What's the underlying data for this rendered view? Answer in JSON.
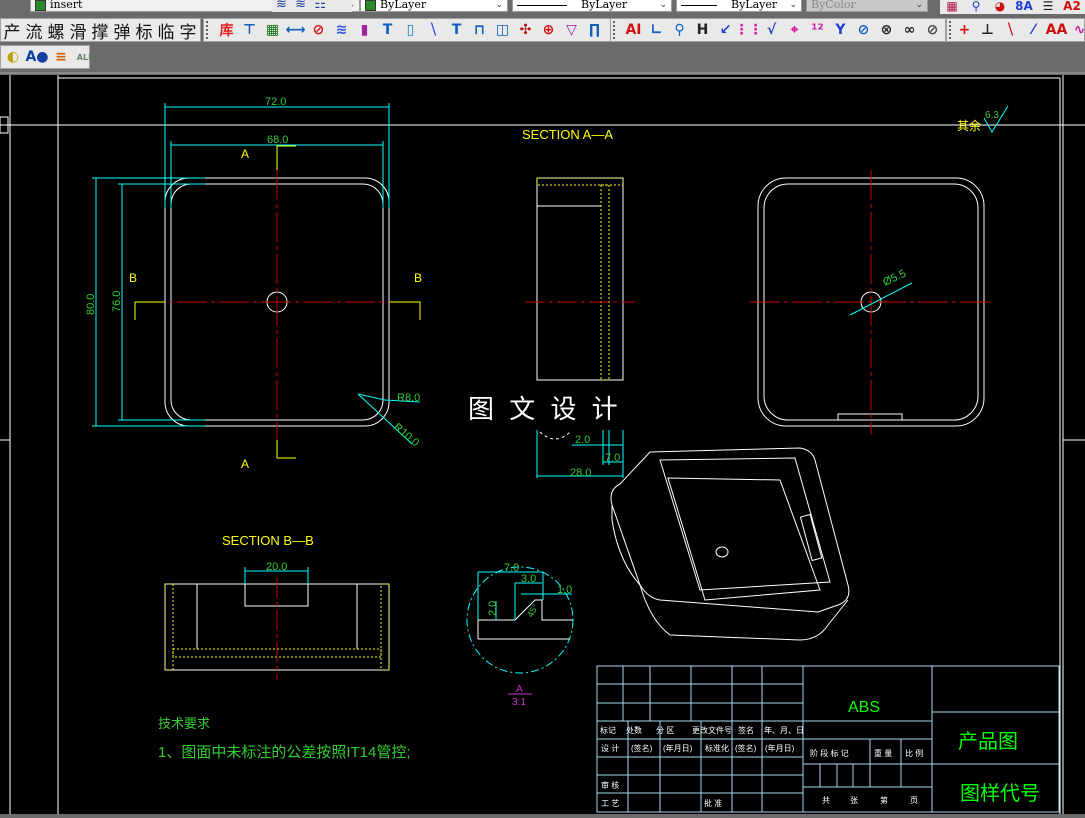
{
  "toolbar_top": {
    "layer_name": "insert",
    "color": "ByLayer",
    "linetype": "ByLayer",
    "lineweight": "ByLayer",
    "plotstyle": "ByColor"
  },
  "toolbar_chinese": [
    "产",
    "流",
    "螺",
    "滑",
    "撑",
    "弹",
    "标",
    "临",
    "字"
  ],
  "toolbar_icons_1": [
    {
      "name": "library-icon",
      "glyph": "库",
      "color": "#e02020"
    },
    {
      "name": "hole-icon",
      "glyph": "⊤",
      "color": "#1060c0"
    },
    {
      "name": "bearing-icon",
      "glyph": "▦",
      "color": "#107010"
    },
    {
      "name": "shaft-icon",
      "glyph": "⟷",
      "color": "#1060c0"
    },
    {
      "name": "gear-icon",
      "glyph": "⊘",
      "color": "#d01010"
    },
    {
      "name": "spring-icon",
      "glyph": "≋",
      "color": "#3050e0"
    },
    {
      "name": "screw-icon",
      "glyph": "▮",
      "color": "#a020a0"
    },
    {
      "name": "t-slot-icon",
      "glyph": "T",
      "color": "#1060c0"
    },
    {
      "name": "pin-icon",
      "glyph": "▯",
      "color": "#1080c0"
    },
    {
      "name": "hatch-icon",
      "glyph": "⧹",
      "color": "#3050e0"
    },
    {
      "name": "bolt-icon",
      "glyph": "T",
      "color": "#1060c0"
    },
    {
      "name": "nut-icon",
      "glyph": "⊓",
      "color": "#1060c0"
    },
    {
      "name": "coupling-icon",
      "glyph": "◫",
      "color": "#1060c0"
    },
    {
      "name": "chain-icon",
      "glyph": "✣",
      "color": "#b01010"
    },
    {
      "name": "center-mark-icon",
      "glyph": "⊕",
      "color": "#d01010"
    },
    {
      "name": "countersink-icon",
      "glyph": "▽",
      "color": "#a020a0"
    },
    {
      "name": "bracket-icon",
      "glyph": "∏",
      "color": "#1060c0"
    }
  ],
  "toolbar_icons_2": [
    {
      "name": "text-icon",
      "glyph": "AI",
      "color": "#d01010"
    },
    {
      "name": "coordinate-icon",
      "glyph": "∟",
      "color": "#1060c0"
    },
    {
      "name": "leader-icon",
      "glyph": "⚲",
      "color": "#1060c0"
    },
    {
      "name": "dimension-icon",
      "glyph": "H",
      "color": "#222"
    },
    {
      "name": "tolerance-icon",
      "glyph": "↙",
      "color": "#2040d0"
    },
    {
      "name": "numbering-icon",
      "glyph": "⋮⋮",
      "color": "#d020a0"
    },
    {
      "name": "roughness-icon",
      "glyph": "√",
      "color": "#2040d0"
    },
    {
      "name": "datum-icon",
      "glyph": "⌖",
      "color": "#d020a0"
    },
    {
      "name": "sequence-icon",
      "glyph": "¹²",
      "color": "#d020a0"
    },
    {
      "name": "weld-icon",
      "glyph": "Y",
      "color": "#2040d0"
    },
    {
      "name": "diameter-icon",
      "glyph": "⊘",
      "color": "#1060c0"
    },
    {
      "name": "radius-icon",
      "glyph": "⊗",
      "color": "#222"
    },
    {
      "name": "edit-icon",
      "glyph": "∞",
      "color": "#222"
    },
    {
      "name": "erase-icon",
      "glyph": "⊘",
      "color": "#444"
    }
  ],
  "toolbar_icons_3": [
    {
      "name": "centerline-icon",
      "glyph": "+",
      "color": "#d01010"
    },
    {
      "name": "break-icon",
      "glyph": "⊥",
      "color": "#222"
    },
    {
      "name": "hatch-line-icon",
      "glyph": "⧹",
      "color": "#d01010"
    },
    {
      "name": "scale-icon",
      "glyph": "⁄",
      "color": "#2040d0"
    },
    {
      "name": "text-align-icon",
      "glyph": "AA",
      "color": "#d01010"
    },
    {
      "name": "curve-icon",
      "glyph": "∿",
      "color": "#d020a0"
    }
  ],
  "toolbar_icons_top_right": [
    {
      "name": "table-icon",
      "glyph": "▦",
      "color": "#b01040"
    },
    {
      "name": "zoom-icon",
      "glyph": "⚲",
      "color": "#2040d0"
    },
    {
      "name": "properties-icon",
      "glyph": "◕",
      "color": "#d01010"
    },
    {
      "name": "layer-state-icon",
      "glyph": "8Â",
      "color": "#2040d0"
    },
    {
      "name": "list-icon",
      "glyph": "☰",
      "color": "#222"
    },
    {
      "name": "text-style-icon",
      "glyph": "A2",
      "color": "#d01010"
    }
  ],
  "toolbar_row3": [
    {
      "name": "layer-match-icon",
      "glyph": "◐",
      "color": "#c0a000"
    },
    {
      "name": "text-match-icon",
      "glyph": "A●",
      "color": "#1040a0"
    },
    {
      "name": "layer-stack-icon",
      "glyph": "≡",
      "color": "#d06000"
    },
    {
      "name": "all-dim-icon",
      "glyph": "ALL",
      "color": "#608060"
    }
  ],
  "drawing": {
    "section_aa": "SECTION  A—A",
    "section_bb": "SECTION  B—B",
    "label_a": "A",
    "label_b": "B",
    "dims_front": {
      "width_outer": "72.0",
      "width_inner": "68.0",
      "height_outer": "80.0",
      "height_inner": "76.0",
      "r_inner": "R8.0",
      "r_outer": "R10.0"
    },
    "dims_section_aa": {
      "d1": "2.0",
      "d2": "7.0",
      "d3": "28.0"
    },
    "dims_side": {
      "hole": "Ø5.5"
    },
    "dims_section_bb": {
      "slot": "20.0"
    },
    "dims_detail": {
      "a": "7.0",
      "b": "3.0",
      "c": "1.0",
      "d": "2.0",
      "angle": "45°"
    },
    "detail_label": "A",
    "detail_scale": "3:1",
    "roughness_prefix": "其余",
    "roughness_value": "6.3",
    "watermark": "图 文 设 计",
    "tech_title": "技术要求",
    "tech_note": "1、图面中未标注的公差按照IT14管控;"
  },
  "title_block": {
    "row_headers": [
      "标记",
      "处数",
      "分 区",
      "更改文件号",
      "签名",
      "年、月、日"
    ],
    "design_row": [
      "设 计",
      "(签名)",
      "(年月日)",
      "标准化",
      "(签名)",
      "(年月日)"
    ],
    "review": "审 核",
    "process": "工 艺",
    "approve": "批 准",
    "stage_labels": [
      "阶 段 标 记",
      "重 量",
      "比 例"
    ],
    "sheet_labels": [
      "共",
      "张",
      "第",
      "页"
    ],
    "material": "ABS",
    "drawing_name": "产品图",
    "drawing_code": "图样代号"
  },
  "colors": {
    "background": "#000000",
    "geometry": "#ffffff",
    "dimension": "#00ffff",
    "dim_text": "#33cc33",
    "centerline": "#cc0000",
    "section": "#ffff00",
    "frame": "#a8d8f0",
    "detail_label": "#cc33cc",
    "title_text": "#00ff00"
  }
}
